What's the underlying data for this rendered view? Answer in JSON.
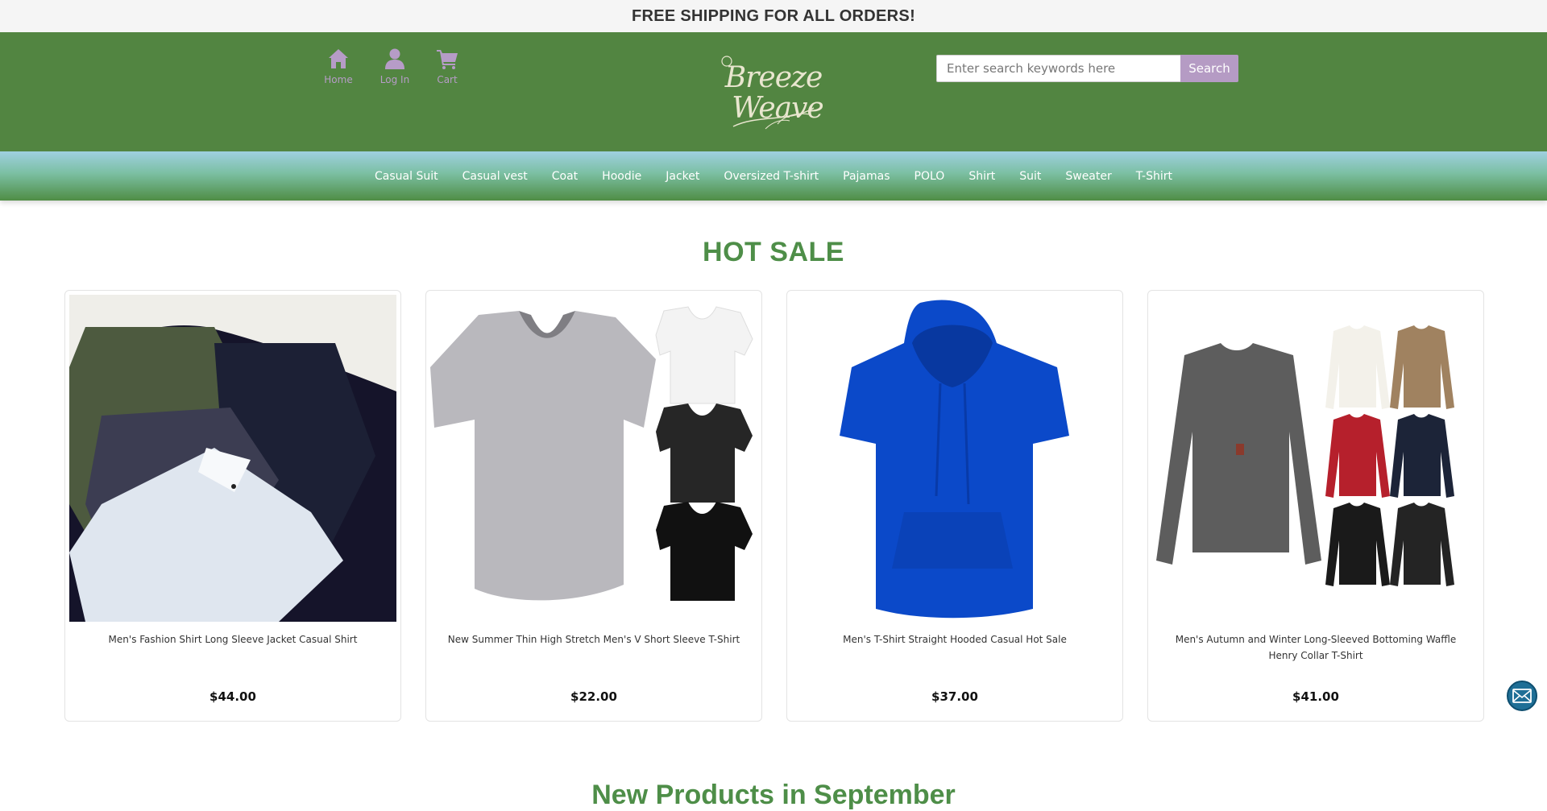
{
  "announcement": "FREE SHIPPING FOR ALL ORDERS!",
  "header": {
    "icons": [
      {
        "label": "Home",
        "icon": "home-icon"
      },
      {
        "label": "Log In",
        "icon": "user-icon"
      },
      {
        "label": "Cart",
        "icon": "cart-icon"
      }
    ],
    "logo_line1": "Breeze",
    "logo_line2": "Weave",
    "search": {
      "placeholder": "Enter search keywords here",
      "button": "Search"
    }
  },
  "nav": [
    "Casual Suit",
    "Casual vest",
    "Coat",
    "Hoodie",
    "Jacket",
    "Oversized T-shirt",
    "Pajamas",
    "POLO",
    "Shirt",
    "Suit",
    "Sweater",
    "T-Shirt"
  ],
  "hot_sale": {
    "title": "HOT SALE",
    "products": [
      {
        "name": "Men's Fashion Shirt Long Sleeve Jacket Casual Shirt",
        "price": "$44.00"
      },
      {
        "name": "New Summer Thin High Stretch Men's V Short Sleeve T-Shirt",
        "price": "$22.00"
      },
      {
        "name": "Men's T-Shirt Straight Hooded Casual Hot Sale",
        "price": "$37.00"
      },
      {
        "name": "Men's Autumn and Winter Long-Sleeved Bottoming Waffle Henry Collar T-Shirt",
        "price": "$41.00"
      }
    ]
  },
  "new_products": {
    "title": "New Products in September"
  },
  "colors": {
    "header_green": "#528541",
    "accent_purple": "#b59bc4",
    "title_green": "#4e8e48"
  }
}
